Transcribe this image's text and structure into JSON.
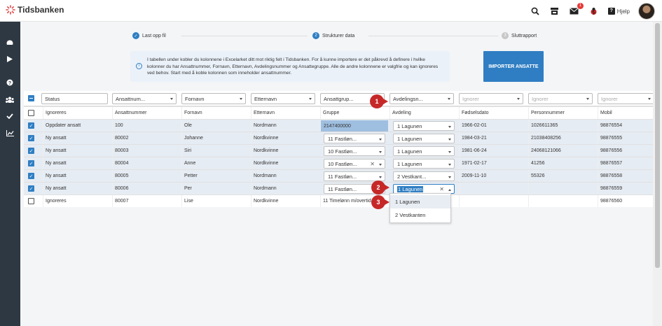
{
  "app": {
    "logo_text": "Tidsbanken",
    "help_label": "Hjelp",
    "mail_badge": "1"
  },
  "stepper": {
    "steps": [
      {
        "num": "",
        "label": "Last opp fil",
        "state": "done"
      },
      {
        "num": "2",
        "label": "Strukturer data",
        "state": "active"
      },
      {
        "num": "3",
        "label": "Sluttrapport",
        "state": "pending"
      }
    ]
  },
  "info": {
    "icon": "i",
    "text": "I tabellen under kobler du kolonnene i Excelarket ditt mot riktig felt i Tidsbanken. For å kunne importere er det påkrevd å definere i hvilke kolonner du har Ansattnummer, Fornavn, Etternavn, Avdelingsnummer og Ansattegruppe. Alle de andre kolonnene er valgfrie og kan ignoreres ved behov. Start med å koble kolonnen som inneholder ansattnummer."
  },
  "import_button": "IMPORTER ANSATTE",
  "columns": [
    {
      "select": "Status",
      "header": "Ignoreres"
    },
    {
      "select": "Ansattnum...",
      "header": "Ansattnummer"
    },
    {
      "select": "Fornavn",
      "header": "Fornavn"
    },
    {
      "select": "Etternavn",
      "header": "Etternavn"
    },
    {
      "select": "Ansattgrup...",
      "header": "Gruppe"
    },
    {
      "select": "Avdelingsn...",
      "header": "Avdeling"
    },
    {
      "select": "Ignorer",
      "header": "Fødselsdato"
    },
    {
      "select": "Ignorer",
      "header": "Personnummer"
    },
    {
      "select": "Ignorer",
      "header": "Mobil"
    }
  ],
  "rows": [
    {
      "status": "Oppdater ansatt",
      "ansattnr": "100",
      "fornavn": "Ole",
      "etternavn": "Nordmann",
      "gruppe": "2147400000",
      "avdeling": "1 Lagunen",
      "fodsel": "1966-02-01",
      "personnr": "1026611365",
      "mobil": "98876554"
    },
    {
      "status": "Ny ansatt",
      "ansattnr": "80002",
      "fornavn": "Johanne",
      "etternavn": "Nordkvinne",
      "gruppe": "11 Fastløn...",
      "avdeling": "1 Lagunen",
      "fodsel": "1984-03-21",
      "personnr": "21038408256",
      "mobil": "98876555"
    },
    {
      "status": "Ny ansatt",
      "ansattnr": "80003",
      "fornavn": "Siri",
      "etternavn": "Nordkvinne",
      "gruppe": "10 Fastløn...",
      "avdeling": "1 Lagunen",
      "fodsel": "1981-06-24",
      "personnr": "24068121066",
      "mobil": "98876556"
    },
    {
      "status": "Ny ansatt",
      "ansattnr": "80004",
      "fornavn": "Anne",
      "etternavn": "Nordkvinne",
      "gruppe": "10 Fastløn...",
      "avdeling": "1 Lagunen",
      "fodsel": "1971-02-17",
      "personnr": "41256",
      "mobil": "98876557"
    },
    {
      "status": "Ny ansatt",
      "ansattnr": "80005",
      "fornavn": "Petter",
      "etternavn": "Nordmann",
      "gruppe": "11 Fastløn...",
      "avdeling": "2 Vestkant...",
      "fodsel": "2009-11-10",
      "personnr": "55326",
      "mobil": "98876558"
    },
    {
      "status": "Ny ansatt",
      "ansattnr": "80006",
      "fornavn": "Per",
      "etternavn": "Nordmann",
      "gruppe": "11 Fastløn...",
      "avdeling": "1 Lagunen",
      "fodsel": "",
      "personnr": "",
      "mobil": "98876559"
    },
    {
      "status": "Ignoreres",
      "ansattnr": "80007",
      "fornavn": "Lise",
      "etternavn": "Nordkvinne",
      "gruppe": "11 Timelønn m/overtid",
      "avdeling": "",
      "fodsel": "",
      "personnr": "",
      "mobil": "98876560"
    }
  ],
  "dropdown_menu": {
    "options": [
      "1 Lagunen",
      "2 Vestkanten"
    ]
  },
  "markers": [
    "1",
    "2",
    "3"
  ],
  "colors": {
    "accent": "#2f7ec3",
    "sidebar": "#2e3842",
    "marker": "#c62828"
  }
}
